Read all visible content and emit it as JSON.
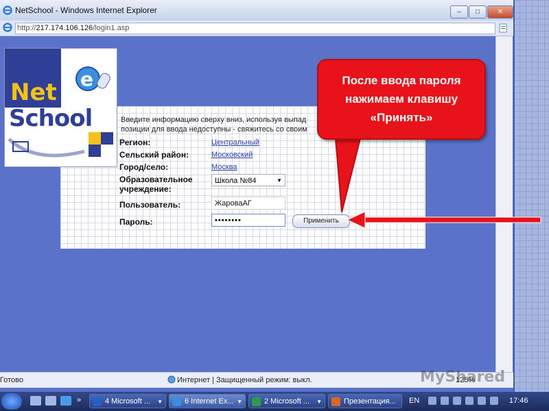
{
  "window": {
    "title": "NetSchool - Windows Internet Explorer",
    "min_label": "–",
    "max_label": "□",
    "close_label": "✕"
  },
  "address": {
    "scheme": "http://",
    "host": "217.174.106.126",
    "path": "/login1.asp"
  },
  "logo": {
    "line1": "Net",
    "line2": "School"
  },
  "form": {
    "intro_line1": "Введите информацию сверху вниз, используя выпад",
    "intro_line2": "позиции для ввода недоступны - свяжитесь со своим",
    "region_label": "Регион:",
    "region_value": "Центральный",
    "district_label": "Сельский район:",
    "district_value": "Московский",
    "city_label": "Город/село:",
    "city_value": "Москва",
    "school_label_line1": "Образовательное",
    "school_label_line2": "учреждение:",
    "school_value": "Школа №84",
    "user_label": "Пользователь:",
    "user_value": "ЖароваАГ",
    "password_label": "Пароль:",
    "password_value": "••••••••",
    "accept_label": "Применить"
  },
  "callout": {
    "line1": "После ввода пароля",
    "line2": "нажимаем клавишу",
    "line3": "«Принять»",
    "color": "#e8121a"
  },
  "status": {
    "ready": "Готово",
    "zone": "Интернет | Защищенный режим: выкл.",
    "zoom": "125%"
  },
  "watermark": "MyShared",
  "taskbar": {
    "tasks": [
      {
        "label": "4 Microsoft ...",
        "icon": "word-icon",
        "color": "#2b5fc7"
      },
      {
        "label": "6 Internet Ex...",
        "icon": "ie-icon",
        "color": "#3a8fe0"
      },
      {
        "label": "2 Microsoft ...",
        "icon": "excel-icon",
        "color": "#2f9a4a"
      },
      {
        "label": "Презентация...",
        "icon": "powerpoint-icon",
        "color": "#d9672a"
      }
    ],
    "lang": "EN",
    "clock": "17:46"
  }
}
